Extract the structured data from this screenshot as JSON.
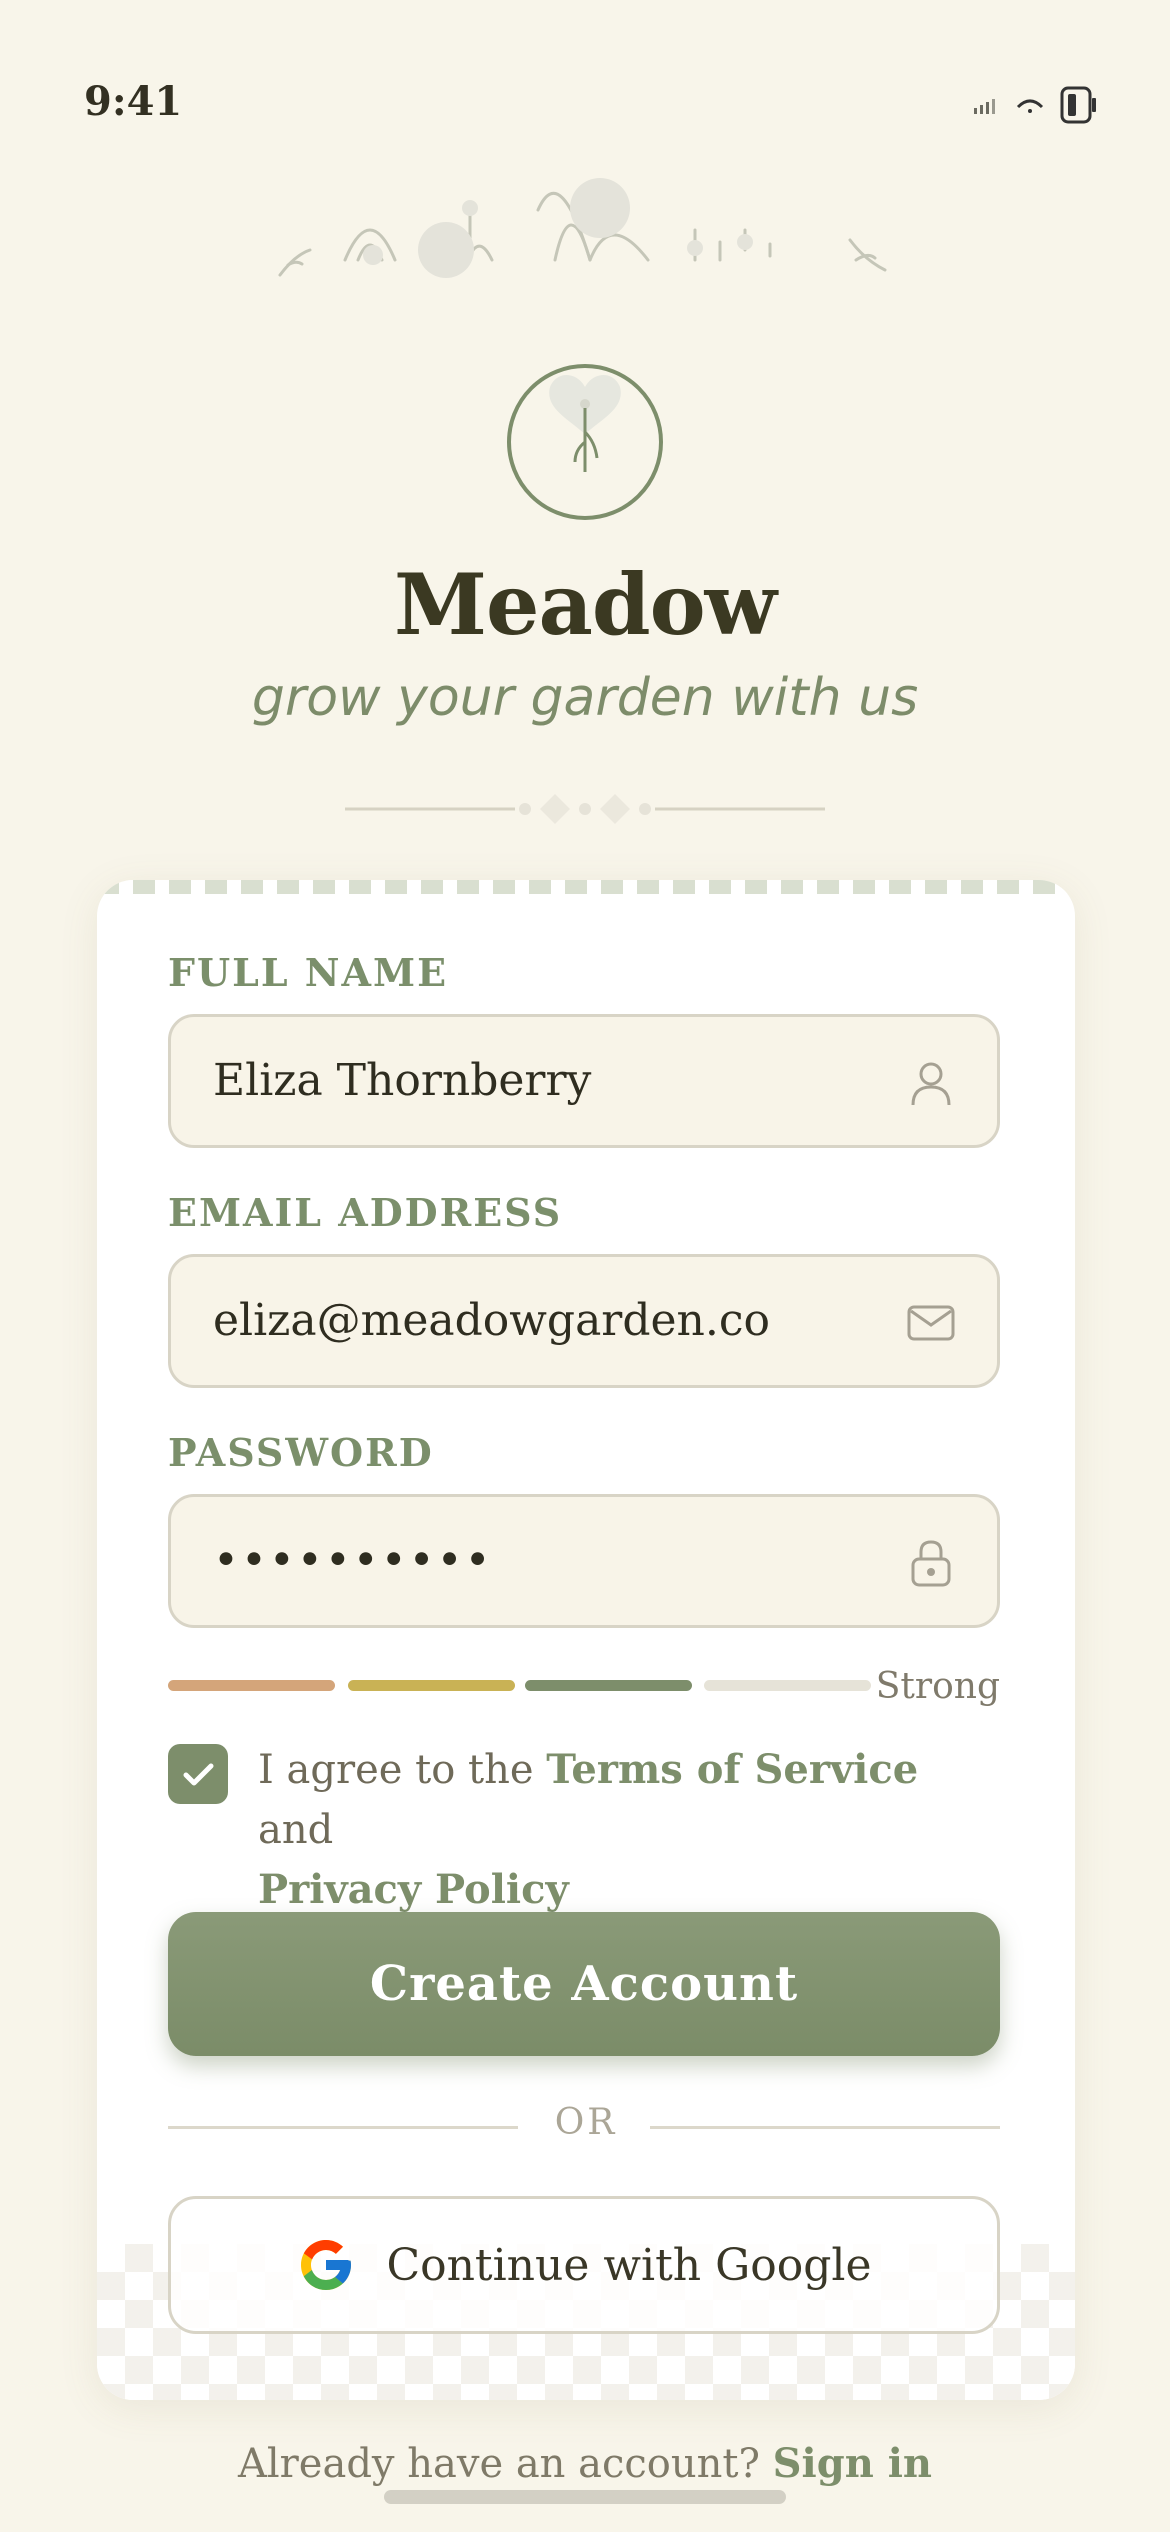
{
  "status_bar": {
    "time": "9:41"
  },
  "app": {
    "name": "Meadow",
    "tagline": "grow your garden with us"
  },
  "form": {
    "full_name": {
      "label": "FULL NAME",
      "value": "Eliza Thornberry",
      "icon": "person-icon"
    },
    "email": {
      "label": "EMAIL ADDRESS",
      "value": "eliza@meadowgarden.co",
      "icon": "mail-icon"
    },
    "password": {
      "label": "PASSWORD",
      "masked_value": "••••••••••",
      "icon": "lock-icon"
    },
    "strength": {
      "label": "Strong",
      "filled_segments": 3,
      "total_segments": 4,
      "colors": [
        "#d4a57a",
        "#c9b255",
        "#7d8e6b",
        "#e6e3d8"
      ]
    },
    "terms": {
      "checked": true,
      "prefix": "I agree to the ",
      "terms_link": "Terms of Service",
      "middle": " and",
      "privacy_link": "Privacy Policy"
    },
    "submit_label": "Create Account",
    "divider_text": "OR",
    "google_label": "Continue with Google"
  },
  "footer": {
    "prompt": "Already have an account? ",
    "sign_in_link": "Sign in"
  },
  "colors": {
    "background": "#f8f5ea",
    "accent": "#7d8e6b",
    "title": "#3b3922"
  }
}
